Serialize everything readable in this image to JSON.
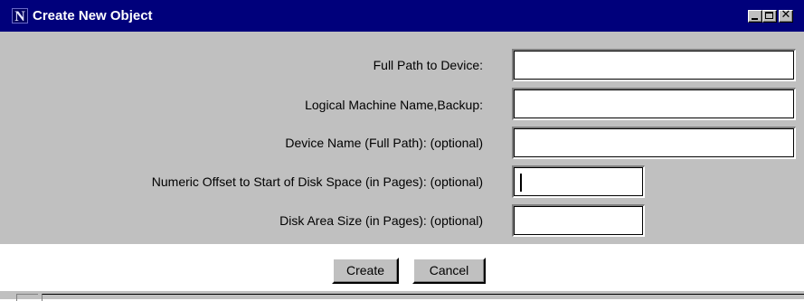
{
  "window": {
    "title": "Create New Object",
    "app_icon_letter": "N",
    "controls": {
      "minimize": "minimize-icon",
      "maximize": "maximize-icon",
      "close": "close-icon",
      "close_glyph": "✕"
    }
  },
  "form": {
    "fields": [
      {
        "label": "Full Path to Device:",
        "value": ""
      },
      {
        "label": "Logical Machine Name,Backup:",
        "value": ""
      },
      {
        "label": "Device Name (Full Path): (optional)",
        "value": ""
      },
      {
        "label": "Numeric Offset to Start of Disk Space (in Pages): (optional)",
        "value": ""
      },
      {
        "label": "Disk Area Size (in Pages): (optional)",
        "value": ""
      }
    ]
  },
  "buttons": {
    "create": "Create",
    "cancel": "Cancel"
  },
  "colors": {
    "title_bar": "#00007b",
    "dialog_face": "#c0c0c0",
    "field_background": "#ffffff"
  }
}
